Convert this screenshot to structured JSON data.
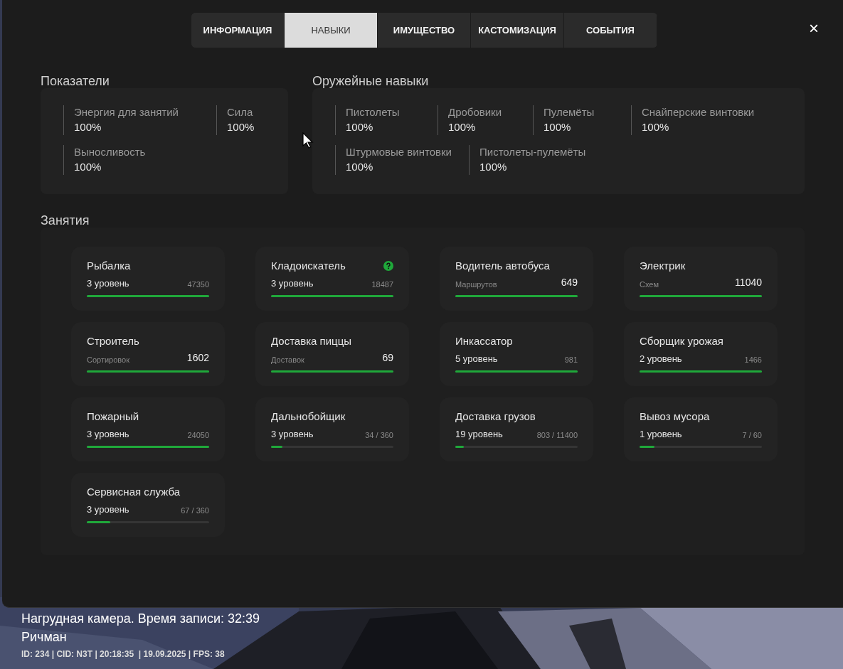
{
  "tabs": [
    {
      "label": "ИНФОРМАЦИЯ",
      "selected": false
    },
    {
      "label": "НАВЫКИ",
      "selected": true
    },
    {
      "label": "ИМУЩЕСТВО",
      "selected": false
    },
    {
      "label": "КАСТОМИЗАЦИЯ",
      "selected": false
    },
    {
      "label": "СОБЫТИЯ",
      "selected": false
    }
  ],
  "close": "×",
  "indicators": {
    "title": "Показатели",
    "items": [
      {
        "label": "Энергия для занятий",
        "value": "100%"
      },
      {
        "label": "Сила",
        "value": "100%"
      },
      {
        "label": "Выносливость",
        "value": "100%"
      }
    ]
  },
  "weapon_skills": {
    "title": "Оружейные навыки",
    "items": [
      {
        "label": "Пистолеты",
        "value": "100%"
      },
      {
        "label": "Дробовики",
        "value": "100%"
      },
      {
        "label": "Пулемёты",
        "value": "100%"
      },
      {
        "label": "Снайперские винтовки",
        "value": "100%"
      },
      {
        "label": "Штурмовые винтовки",
        "value": "100%"
      },
      {
        "label": "Пистолеты-пулемёты",
        "value": "100%"
      }
    ]
  },
  "jobs": {
    "title": "Занятия",
    "items": [
      {
        "name": "Рыбалка",
        "kind": "level",
        "subtitle": "3 уровень",
        "value": "47350",
        "level": 1,
        "help": false
      },
      {
        "name": "Кладоискатель",
        "kind": "level",
        "subtitle": "3 уровень",
        "value": "18487",
        "level": 1,
        "help": true
      },
      {
        "name": "Водитель автобуса",
        "kind": "count",
        "subtitle": "Маршрутов",
        "value": "649",
        "level": 1,
        "help": false
      },
      {
        "name": "Электрик",
        "kind": "count",
        "subtitle": "Схем",
        "value": "11040",
        "level": 1,
        "help": false
      },
      {
        "name": "Строитель",
        "kind": "count",
        "subtitle": "Сортировок",
        "value": "1602",
        "level": 1,
        "help": false
      },
      {
        "name": "Доставка пиццы",
        "kind": "count",
        "subtitle": "Доставок",
        "value": "69",
        "level": 1,
        "help": false
      },
      {
        "name": "Инкассатор",
        "kind": "level",
        "subtitle": "5 уровень",
        "value": "981",
        "level": 1,
        "help": false
      },
      {
        "name": "Сборщик урожая",
        "kind": "level",
        "subtitle": "2 уровень",
        "value": "1466",
        "level": 1,
        "help": false
      },
      {
        "name": "Пожарный",
        "kind": "level",
        "subtitle": "3 уровень",
        "value": "24050",
        "level": 1,
        "help": false
      },
      {
        "name": "Дальнобойщик",
        "kind": "level",
        "subtitle": "3 уровень",
        "value": "34 / 360",
        "level": 0.094,
        "help": false
      },
      {
        "name": "Доставка грузов",
        "kind": "level",
        "subtitle": "19 уровень",
        "value": "803 / 11400",
        "level": 0.07,
        "help": false
      },
      {
        "name": "Вывоз мусора",
        "kind": "level",
        "subtitle": "1 уровень",
        "value": "7 / 60",
        "level": 0.12,
        "help": false
      },
      {
        "name": "Сервисная служба",
        "kind": "level",
        "subtitle": "3 уровень",
        "value": "67 / 360",
        "level": 0.19,
        "help": false
      }
    ]
  },
  "overlay": {
    "camera": "Нагрудная камера. Время записи: 32:39",
    "name": "Ричман",
    "info": "ID: 234 | CID: N3T | 20:18:35  | 19.09.2025 | FPS: 38"
  }
}
